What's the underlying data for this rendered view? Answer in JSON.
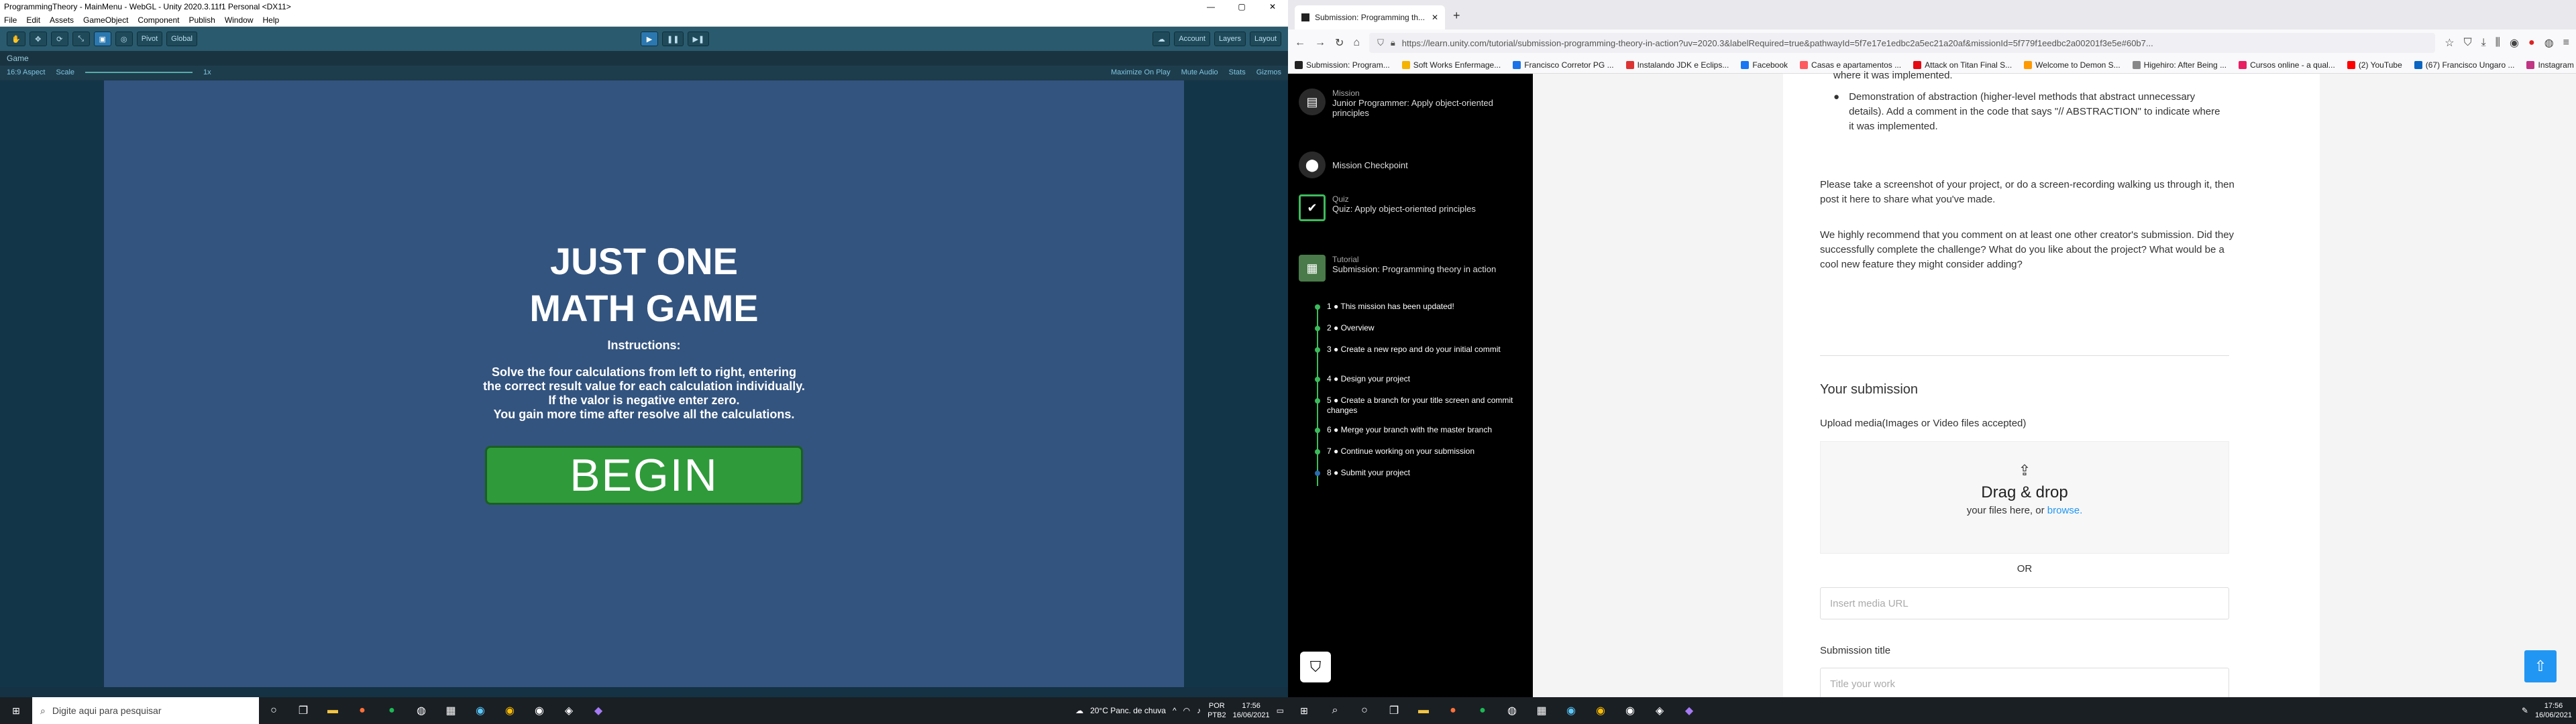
{
  "unity": {
    "title": "ProgrammingTheory - MainMenu - WebGL - Unity 2020.3.11f1 Personal <DX11>",
    "menu": [
      "File",
      "Edit",
      "Assets",
      "GameObject",
      "Component",
      "Publish",
      "Window",
      "Help"
    ],
    "toolbar": {
      "pivot": "Pivot",
      "global": "Global",
      "account": "Account",
      "layers": "Layers",
      "layout": "Layout"
    },
    "game_tab": "Game",
    "aspect": "16:9 Aspect",
    "scale_label": "Scale",
    "scale_value": "1x",
    "toggles": [
      "Maximize On Play",
      "Mute Audio",
      "Stats",
      "Gizmos"
    ]
  },
  "game": {
    "title_line1": "JUST ONE",
    "title_line2": "MATH GAME",
    "instructions_heading": "Instructions:",
    "instructions": [
      "Solve the four calculations from left to right, entering",
      "the correct result value for each calculation individually.",
      "If the valor is negative enter zero.",
      "You gain more time after resolve all the calculations."
    ],
    "begin_label": "BEGIN"
  },
  "taskbar_left": {
    "search_placeholder": "Digite aqui para pesquisar",
    "weather": "20°C  Panc. de chuva",
    "lang1": "POR",
    "lang2": "PTB2",
    "time": "17:56",
    "date": "16/06/2021"
  },
  "browser": {
    "tab_title": "Submission: Programming th...",
    "url": "https://learn.unity.com/tutorial/submission-programming-theory-in-action?uv=2020.3&labelRequired=true&pathwayId=5f7e17e1edbc2a5ec21a20af&missionId=5f779f1eedbc2a00201f3e5e#60b7...",
    "bookmarks": [
      "Submission: Program...",
      "Soft Works Enfermage...",
      "Francisco Corretor PG ...",
      "Instalando JDK e Eclips...",
      "Facebook",
      "Casas e apartamentos ...",
      "Attack on Titan Final S...",
      "Welcome to Demon S...",
      "Higehiro: After Being ...",
      "Cursos online - a qual...",
      "(2) YouTube",
      "(67) Francisco Ungaro ...",
      "Instagram"
    ]
  },
  "sidebar": {
    "mission_label": "Mission",
    "mission_title": "Junior Programmer: Apply object-oriented principles",
    "checkpoint": "Mission Checkpoint",
    "quiz_label": "Quiz",
    "quiz_title": "Quiz: Apply object-oriented principles",
    "tutorial_label": "Tutorial",
    "tutorial_title": "Submission: Programming theory in action",
    "steps": [
      "1 ● This mission has been updated!",
      "2 ● Overview",
      "3 ● Create a new repo and do your initial commit",
      "4 ● Design your project",
      "5 ● Create a branch for your title screen and commit changes",
      "6 ● Merge your branch with the master branch",
      "7 ● Continue working on your submission",
      "8 ● Submit your project"
    ]
  },
  "content": {
    "partial_top": "where it was implemented.",
    "bullet": "Demonstration of abstraction (higher-level methods that abstract unnecessary details). Add a comment in the code that says \"// ABSTRACTION\" to indicate where it was implemented.",
    "para1": "Please take a screenshot of your project, or do a screen-recording walking us through it, then post it here to share what you've made.",
    "para2": "We highly recommend that you comment on at least one other creator's submission. Did they successfully complete the challenge? What do you like about the project? What would be a cool new feature they might consider adding?",
    "your_submission": "Your submission",
    "upload_label": "Upload media(Images or Video files accepted)",
    "drag_drop": "Drag & drop",
    "drop_sub": "your files here, or",
    "browse": "browse.",
    "or": "OR",
    "media_url_placeholder": "Insert media URL",
    "submission_title_label": "Submission title",
    "title_placeholder": "Title your work"
  },
  "taskbar_right": {
    "time": "17:56",
    "date": "16/06/2021"
  }
}
